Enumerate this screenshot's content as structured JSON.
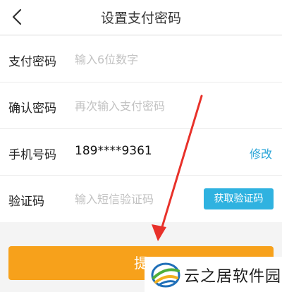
{
  "header": {
    "title": "设置支付密码",
    "back_icon": "chevron-left-icon"
  },
  "form": {
    "pay_password": {
      "label": "支付密码",
      "placeholder": "输入6位数字"
    },
    "confirm_password": {
      "label": "确认密码",
      "placeholder": "再次输入支付密码"
    },
    "phone": {
      "label": "手机号码",
      "value": "189****9361",
      "edit_label": "修改"
    },
    "verify_code": {
      "label": "验证码",
      "placeholder": "输入短信验证码",
      "get_code_label": "获取验证码"
    }
  },
  "submit": {
    "label": "提"
  },
  "watermark": {
    "text": "云之居软件园"
  },
  "colors": {
    "accent_orange": "#f7a11b",
    "accent_blue": "#2fb2e0",
    "arrow_red": "#e8312a"
  }
}
